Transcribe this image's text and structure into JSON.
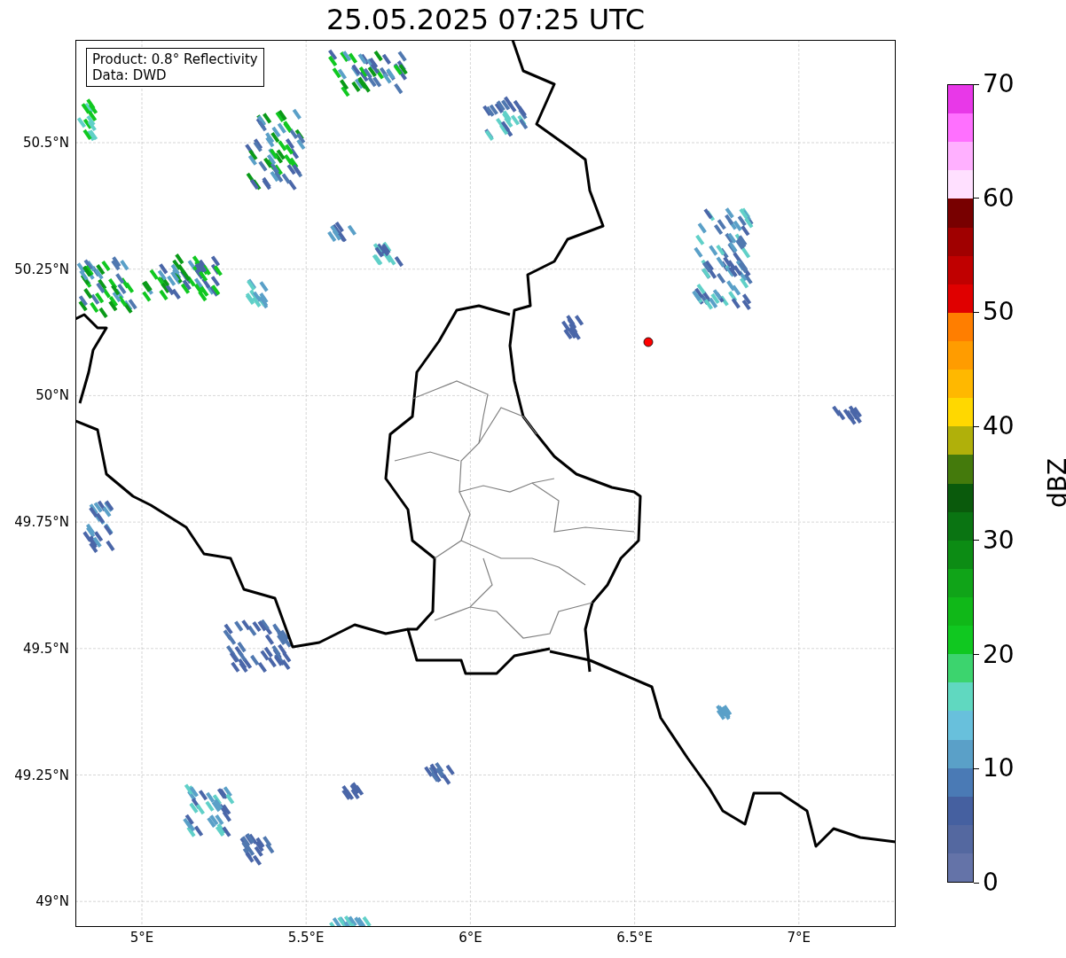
{
  "title": "25.05.2025 07:25 UTC",
  "info_box": {
    "lines": [
      "Product: 0.8° Reflectivity",
      "Data: DWD"
    ]
  },
  "x_ticks": [
    "5°E",
    "5.5°E",
    "6°E",
    "6.5°E",
    "7°E"
  ],
  "y_ticks": [
    "50.5°N",
    "50.25°N",
    "50°N",
    "49.75°N",
    "49.5°N",
    "49.25°N",
    "49°N"
  ],
  "colorbar": {
    "label": "dBZ",
    "ticks": [
      "70",
      "60",
      "50",
      "40",
      "30",
      "20",
      "10",
      "0"
    ],
    "bands": [
      {
        "color": "#e838e8"
      },
      {
        "color": "#ff70ff"
      },
      {
        "color": "#ffb0ff"
      },
      {
        "color": "#ffe0ff"
      },
      {
        "color": "#780000"
      },
      {
        "color": "#a00000"
      },
      {
        "color": "#c00000"
      },
      {
        "color": "#e00000"
      },
      {
        "color": "#ff7e00"
      },
      {
        "color": "#ff9c00"
      },
      {
        "color": "#ffb800"
      },
      {
        "color": "#ffd800"
      },
      {
        "color": "#b0b00a"
      },
      {
        "color": "#447a0c"
      },
      {
        "color": "#0a5a0c"
      },
      {
        "color": "#0a7412"
      },
      {
        "color": "#0c8c14"
      },
      {
        "color": "#10a418"
      },
      {
        "color": "#10b818"
      },
      {
        "color": "#10c820"
      },
      {
        "color": "#3cd46e"
      },
      {
        "color": "#60d8c0"
      },
      {
        "color": "#68c0dc"
      },
      {
        "color": "#5aa0c8"
      },
      {
        "color": "#4a7ab5"
      },
      {
        "color": "#4560a0"
      },
      {
        "color": "#5468a0"
      },
      {
        "color": "#6473a8"
      }
    ]
  }
}
